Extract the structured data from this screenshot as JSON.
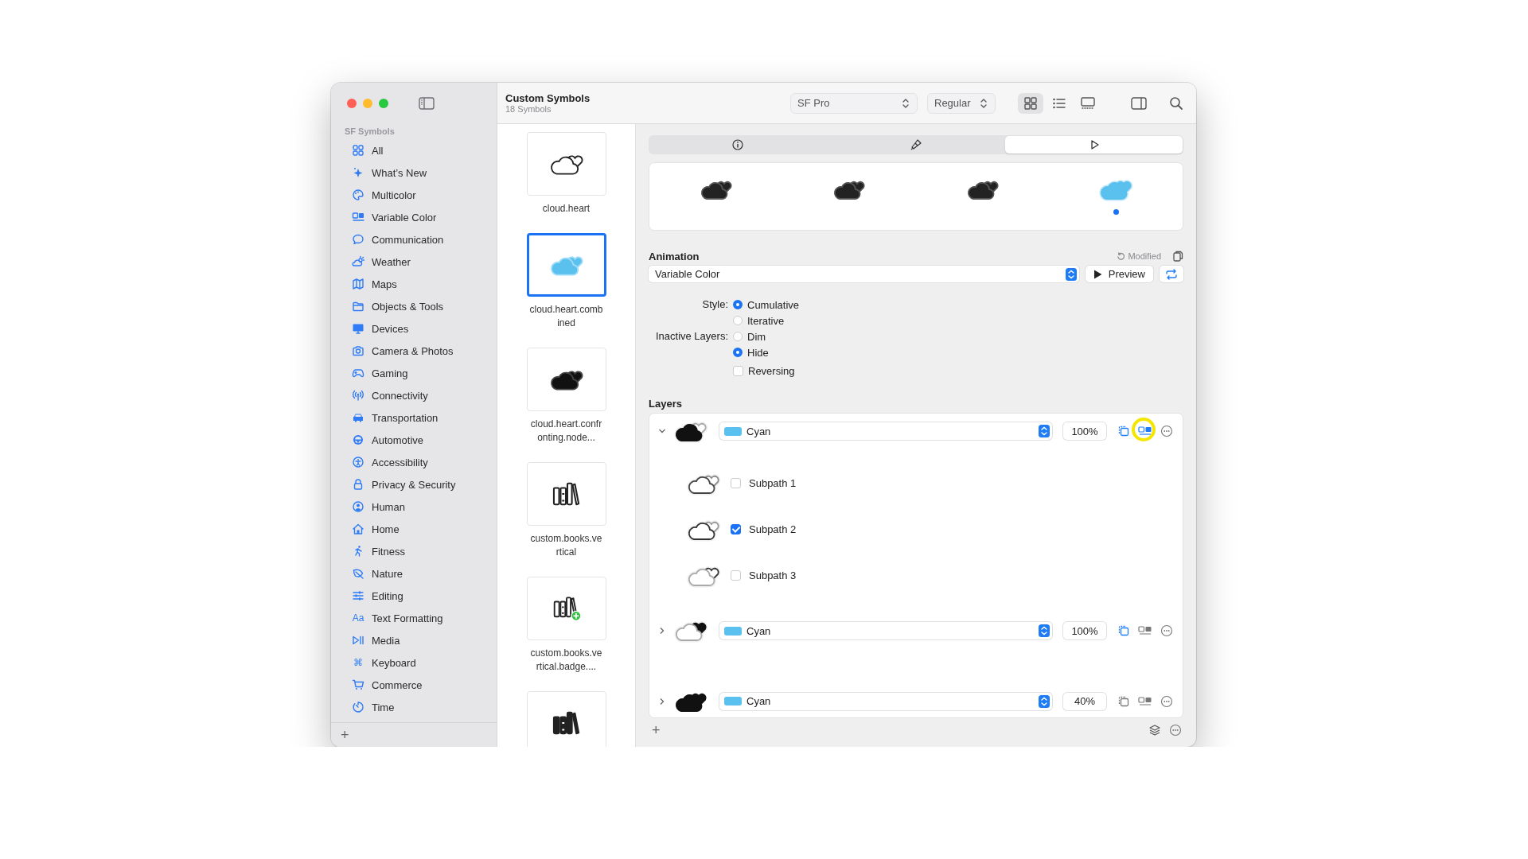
{
  "sidebar": {
    "section": "SF Symbols",
    "items": [
      {
        "label": "All"
      },
      {
        "label": "What’s New"
      },
      {
        "label": "Multicolor"
      },
      {
        "label": "Variable Color"
      },
      {
        "label": "Communication"
      },
      {
        "label": "Weather"
      },
      {
        "label": "Maps"
      },
      {
        "label": "Objects & Tools"
      },
      {
        "label": "Devices"
      },
      {
        "label": "Camera & Photos"
      },
      {
        "label": "Gaming"
      },
      {
        "label": "Connectivity"
      },
      {
        "label": "Transportation"
      },
      {
        "label": "Automotive"
      },
      {
        "label": "Accessibility"
      },
      {
        "label": "Privacy & Security"
      },
      {
        "label": "Human"
      },
      {
        "label": "Home"
      },
      {
        "label": "Fitness"
      },
      {
        "label": "Nature"
      },
      {
        "label": "Editing"
      },
      {
        "label": "Text Formatting",
        "glyph": "Aa"
      },
      {
        "label": "Media"
      },
      {
        "label": "Keyboard",
        "glyph": "⌘"
      },
      {
        "label": "Commerce"
      },
      {
        "label": "Time"
      }
    ],
    "add": "+"
  },
  "header": {
    "title": "Custom Symbols",
    "subtitle": "18 Symbols",
    "font": "SF Pro",
    "weight": "Regular",
    "views": [
      {
        "kind": "grid",
        "selected": true
      },
      {
        "kind": "list",
        "selected": false
      },
      {
        "kind": "gallery",
        "selected": false
      }
    ]
  },
  "symbols": [
    {
      "kind": "cloud-outline",
      "name": "cloud.heart",
      "selected": false
    },
    {
      "kind": "cloud-cyan",
      "name": "cloud.heart.combined",
      "selected": true
    },
    {
      "kind": "cloud-filled",
      "name": "cloud.heart.confronting.node...",
      "selected": false
    },
    {
      "kind": "books-outline",
      "name": "custom.books.vertical",
      "selected": false
    },
    {
      "kind": "books-badge",
      "name": "custom.books.vertical.badge....",
      "selected": false
    },
    {
      "kind": "books-filled",
      "selected": false
    }
  ],
  "inspector": {
    "tabs": [
      {
        "kind": "info",
        "selected": false
      },
      {
        "kind": "brush",
        "selected": false
      },
      {
        "kind": "play",
        "selected": true
      }
    ],
    "frames": [
      {
        "selected": false
      },
      {
        "selected": false
      },
      {
        "selected": false
      },
      {
        "selected": true
      }
    ],
    "animation": {
      "heading": "Animation",
      "modified": "Modified",
      "effect": "Variable Color",
      "preview": "Preview"
    },
    "style": {
      "label": "Style:",
      "options": [
        {
          "label": "Cumulative",
          "selected": true
        },
        {
          "label": "Iterative",
          "selected": false
        }
      ]
    },
    "inactive_layers": {
      "label": "Inactive Layers:",
      "options": [
        {
          "label": "Dim",
          "selected": false
        },
        {
          "label": "Hide",
          "selected": true
        }
      ]
    },
    "reversing": {
      "label": "Reversing",
      "checked": false
    },
    "layers_heading": "Layers",
    "layers": [
      {
        "kind": "cloud",
        "expanded": true,
        "color": "#5ac0ee",
        "color_name": "Cyan",
        "opacity": "100%",
        "copy_on": true,
        "variable_on": true,
        "highlighted": true,
        "children": [
          {
            "kind": "cloud",
            "label": "Subpath 1",
            "checked": false
          },
          {
            "kind": "back",
            "label": "Subpath 2",
            "checked": true
          },
          {
            "kind": "heart",
            "label": "Subpath 3",
            "checked": false
          }
        ]
      },
      {
        "kind": "heart",
        "expanded": false,
        "color": "#5ac0ee",
        "color_name": "Cyan",
        "opacity": "100%",
        "copy_on": true,
        "variable_on": false,
        "highlighted": false
      },
      {
        "kind": "both",
        "expanded": false,
        "color": "#5ac0ee",
        "color_name": "Cyan",
        "opacity": "40%",
        "copy_on": false,
        "variable_on": false,
        "highlighted": false
      }
    ],
    "footer_add": "+"
  }
}
